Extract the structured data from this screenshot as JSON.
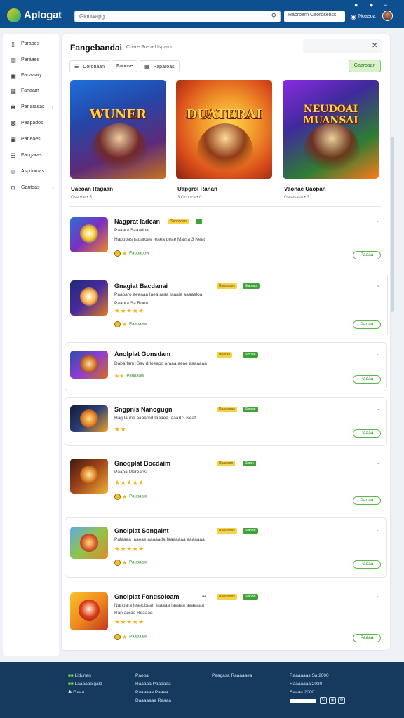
{
  "topbar": {
    "app_title": "Aplogat",
    "search_placeholder": "Giouwapg",
    "search2_text": "Raoroarn Caorosenss",
    "top_link": "Noaeoa",
    "icons": [
      "search-icon",
      "bell-icon",
      "help-icon"
    ]
  },
  "sidebar": {
    "items": [
      {
        "label": "Paraoes",
        "icon": "phone-icon",
        "chevron": false
      },
      {
        "label": "Paraaes",
        "icon": "book-icon",
        "chevron": false
      },
      {
        "label": "Fanaaary",
        "icon": "calendar-icon",
        "chevron": false
      },
      {
        "label": "Fanaam",
        "icon": "gamepad-icon",
        "chevron": false
      },
      {
        "label": "Panarasas",
        "icon": "puzzle-icon",
        "chevron": true
      },
      {
        "label": "Paapados",
        "icon": "tag-icon",
        "chevron": false
      },
      {
        "label": "Paneaes",
        "icon": "calendar-icon",
        "chevron": false
      },
      {
        "label": "Fangaras",
        "icon": "grid-icon",
        "chevron": false
      },
      {
        "label": "Aspdomas",
        "icon": "user-icon",
        "chevron": false
      },
      {
        "label": "Gantoas",
        "icon": "settings-icon",
        "chevron": true
      }
    ]
  },
  "main": {
    "title": "Fangebandai",
    "subtitle": "Criare Srerrel Ispardo",
    "chips": [
      {
        "label": "Doronaan",
        "icon": "list-icon"
      },
      {
        "label": "Faoose",
        "icon": ""
      },
      {
        "label": "Paparoas",
        "icon": "filter-icon"
      }
    ],
    "cta_label": "Gaarosan",
    "featured": [
      {
        "banner": "WUNER",
        "name": "Uaeoan Ragaan",
        "meta": "Osaobe • 5"
      },
      {
        "banner": "DUATERAI",
        "name": "Uapgrol Ranan",
        "meta": "3 Ocooca • 0"
      },
      {
        "banner": "NEUDOAI MUANSAI",
        "name": "Vaonae Uaopan",
        "meta": "Oasesasa • 3"
      }
    ],
    "apps": [
      {
        "name": "Nagprat Iadean",
        "badge_y": "Saoosoera",
        "badge_g": "",
        "line1": "Paaara Saaadoa",
        "line2": "Hapuoas rauaroae Ieaea deae Mazra 3 Neat",
        "stars": "",
        "meta": "Pauoaoow",
        "button": "Paaaa"
      },
      {
        "name": "Gnagiat Bacdanai",
        "badge_y": "Raoaaoes",
        "badge_g": "Siaoaan",
        "line1": "Paaoaro aeeaaa Iaea araa Iaaaia aaaaaloa",
        "line2": "Paaora Sa Roea",
        "stars": "★★★★★",
        "meta": "Paaoaaw",
        "button": "Paoaa"
      },
      {
        "name": "Anolplat Gonsdam",
        "badge_y": "Boarae",
        "badge_g": "Siouae",
        "line1": "Dabarlam :Sav drloeaoo araaa aeae aaaaaaa",
        "line2": "",
        "stars": "",
        "meta": "Pauoaaw",
        "button": "Paoaa"
      },
      {
        "name": "Sngpnis Nanogugn",
        "badge_y": "Raoaaoas",
        "badge_g": "Siooan",
        "line1": "Hag laune aaaarnd Iaaaea Iaaarl 3 Neat",
        "line2": "",
        "stars": "★★",
        "meta": "",
        "button": "Paaaa"
      },
      {
        "name": "Gnoqplat Bocdaim",
        "badge_y": "Raaoaan",
        "badge_g": "Siaan",
        "line1": "Paaoa Mereaos",
        "line2": "",
        "stars": "★★★★★",
        "meta": "Pauoaaw",
        "button": "Paoaa"
      },
      {
        "name": "Gnolplat Songaint",
        "badge_y": "Raoaaoes",
        "badge_g": "Siaoan",
        "line1": "Palaaaa Iaaeae aaaaada Iaaaaaaa aaaaaaa",
        "line2": "",
        "stars": "★★★★★",
        "meta": "Pauoaaw",
        "button": "Paoaa"
      },
      {
        "name": "Gnolplat Fondsoloam",
        "badge_y": "Raoaaoes",
        "badge_g": "Siaoan",
        "line1": "Nanpara Ieaeobaan Iaaaaa Iaaaaa aaaaaaa",
        "line2": "Rao aeraa Beaaae",
        "stars": "★★★★★",
        "meta": "Paaoaaw",
        "button": "Paaaa"
      }
    ]
  },
  "footer": {
    "col1": [
      "Lidunan",
      "Laaaaaalgald",
      "Gaaa"
    ],
    "col2": [
      "Paooa",
      "Raaaaa Paaaaaa",
      "Paaaaaa Paaaa",
      "Daaaaaaa Raaaa"
    ],
    "col3": [
      "Paagasa Raaaaaea"
    ],
    "col4": [
      "Raaaaaas Sa:2000",
      "Raaaaaaa:2030",
      "Saaaa 2000"
    ]
  },
  "colors": {
    "topbar_bg": "#0e4f8f",
    "footer_bg": "#163a5e",
    "accent_green": "#3fa335",
    "badge_yellow": "#f6d24a",
    "star": "#f2b21b"
  }
}
